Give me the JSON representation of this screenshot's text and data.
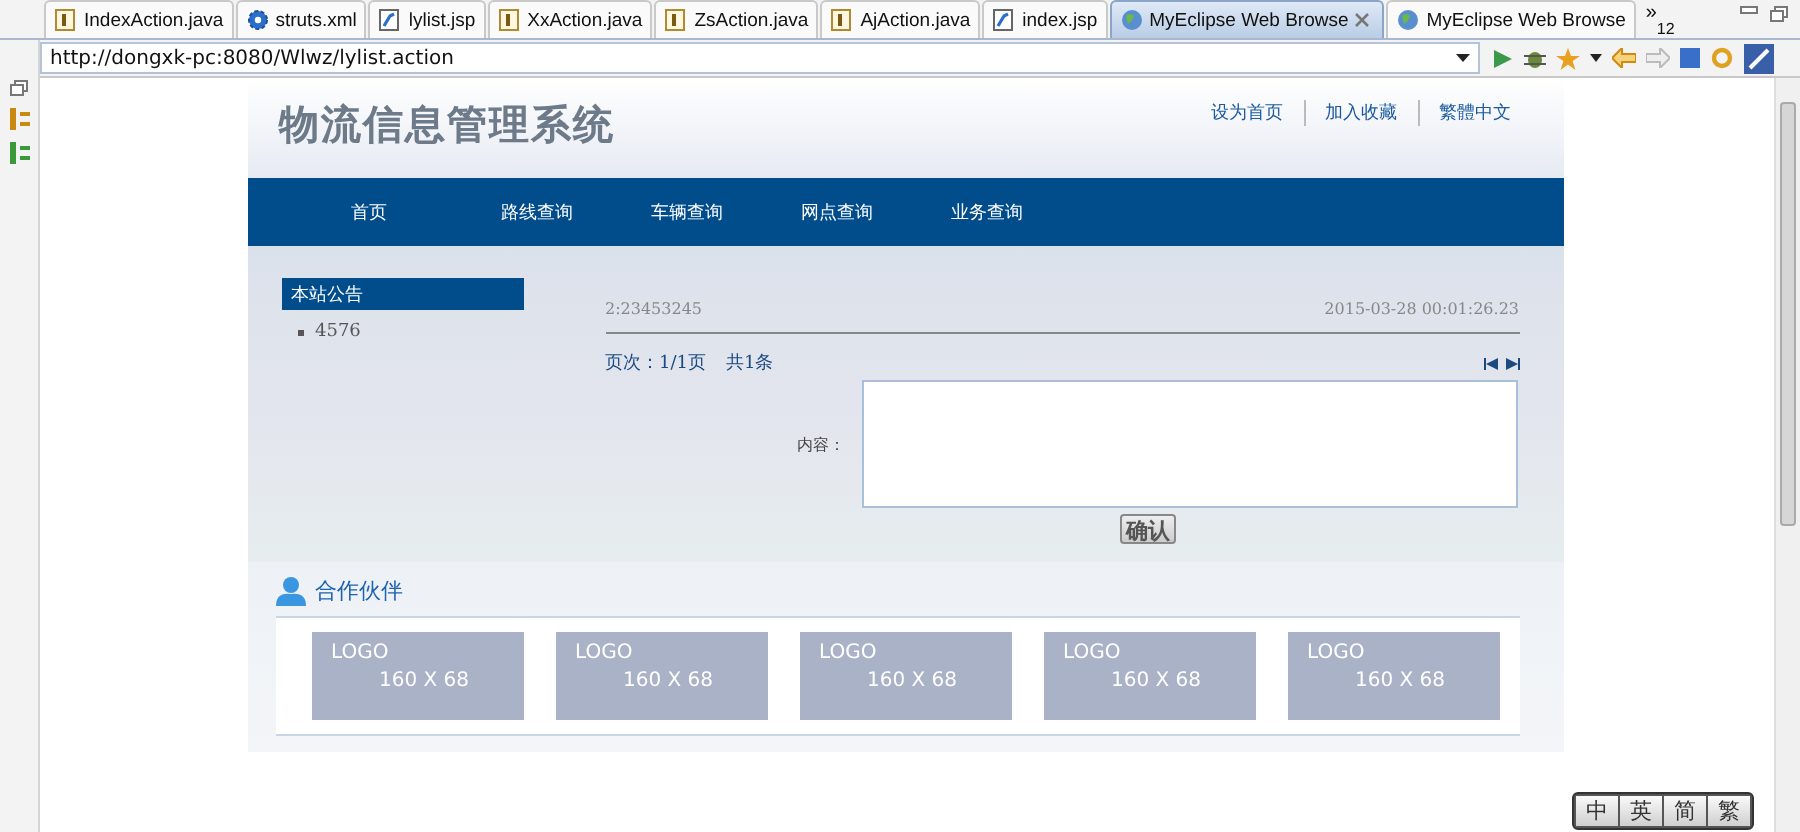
{
  "editor_tabs": [
    {
      "label": "IndexAction.java",
      "kind": "java",
      "selected": false
    },
    {
      "label": "struts.xml",
      "kind": "xml",
      "selected": false
    },
    {
      "label": "lylist.jsp",
      "kind": "jsp",
      "selected": false
    },
    {
      "label": "XxAction.java",
      "kind": "java",
      "selected": false
    },
    {
      "label": "ZsAction.java",
      "kind": "java",
      "selected": false
    },
    {
      "label": "AjAction.java",
      "kind": "java",
      "selected": false
    },
    {
      "label": "index.jsp",
      "kind": "jsp",
      "selected": false
    },
    {
      "label": "MyEclipse Web Browse",
      "kind": "web",
      "selected": true
    },
    {
      "label": "MyEclipse Web Browse",
      "kind": "web",
      "selected": false
    }
  ],
  "overflow_tabs": {
    "label": "»",
    "count": "12"
  },
  "address_bar": {
    "value": "http://dongxk-pc:8080/Wlwz/lylist.action"
  },
  "site": {
    "title": "物流信息管理系统",
    "top_links": [
      "设为首页",
      "加入收藏",
      "繁體中文"
    ],
    "nav": [
      "首页",
      "路线查询",
      "车辆查询",
      "网点查询",
      "业务查询"
    ],
    "sidebar": {
      "heading": "本站公告",
      "items": [
        "4576"
      ]
    },
    "post": {
      "id": "2:23453245",
      "time": "2015-03-28 00:01:26.23"
    },
    "pager": {
      "pages": "页次：1/1页",
      "total": "共1条"
    },
    "form": {
      "label": "内容：",
      "submit": "确认"
    },
    "partners": {
      "heading": "合作伙伴",
      "logos": [
        {
          "line_1": "LOGO",
          "line_2": "160 X 68"
        },
        {
          "line_1": "LOGO",
          "line_2": "160 X 68"
        },
        {
          "line_1": "LOGO",
          "line_2": "160 X 68"
        },
        {
          "line_1": "LOGO",
          "line_2": "160 X 68"
        },
        {
          "line_1": "LOGO",
          "line_2": "160 X 68"
        }
      ]
    }
  },
  "ime_bar": [
    "中",
    "英",
    "简",
    "繁"
  ]
}
